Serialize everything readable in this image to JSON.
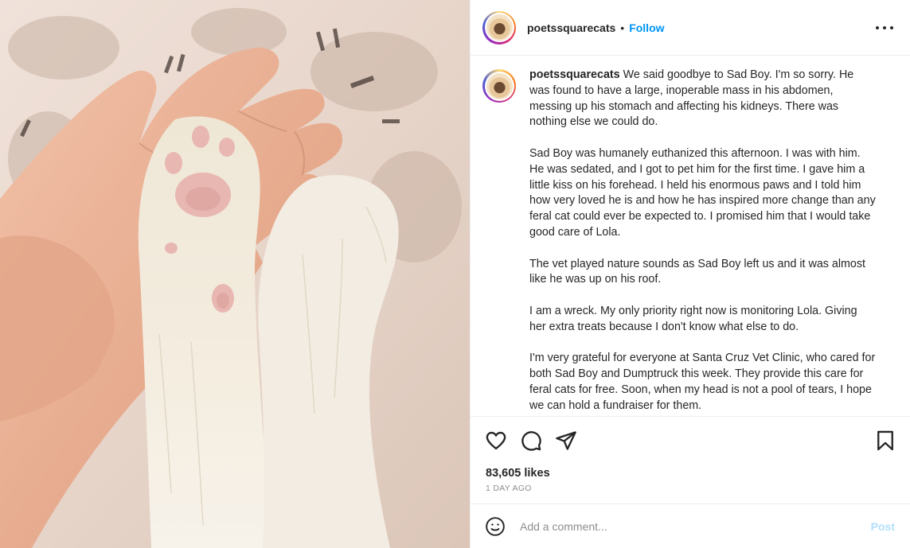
{
  "post": {
    "username": "poetssquarecats",
    "separator": "•",
    "follow_label": "Follow",
    "more_icon": "more-horizontal-icon"
  },
  "caption": {
    "username": "poetssquarecats",
    "paragraphs": [
      "We said goodbye to Sad Boy. I'm so sorry. He was found to have a large, inoperable mass in his abdomen, messing up his stomach and affecting his kidneys. There was nothing else we could do.",
      "Sad Boy was humanely euthanized this afternoon. I was with him. He was sedated, and I got to pet him for the first time. I gave him a little kiss on his forehead. I held his enormous paws and I told him how very loved he is and how he has inspired more change than any feral cat could ever be expected to. I promised him that I would take good care of Lola.",
      "The vet played nature sounds as Sad Boy left us and it was almost like he was up on his roof.",
      "I am a wreck. My only priority right now is monitoring Lola. Giving her extra treats because I don't know what else to do.",
      "I'm very grateful for everyone at Santa Cruz Vet Clinic, who cared for both Sad Boy and Dumptruck this week. They provide this care for feral cats for free. Soon, when my head is not a pool of tears, I hope we can hold a fundraiser for them."
    ]
  },
  "actions": {
    "icons": [
      "heart-icon",
      "comment-icon",
      "share-icon",
      "bookmark-icon"
    ],
    "likes": "83,605 likes",
    "time": "1 DAY AGO"
  },
  "comment": {
    "placeholder": "Add a comment...",
    "post_label": "Post",
    "emoji_icon": "emoji-icon"
  },
  "colors": {
    "accent": "#0095f6",
    "post_disabled": "#b2dffc",
    "secondary_text": "#8e8e8e",
    "border": "#efefef"
  }
}
